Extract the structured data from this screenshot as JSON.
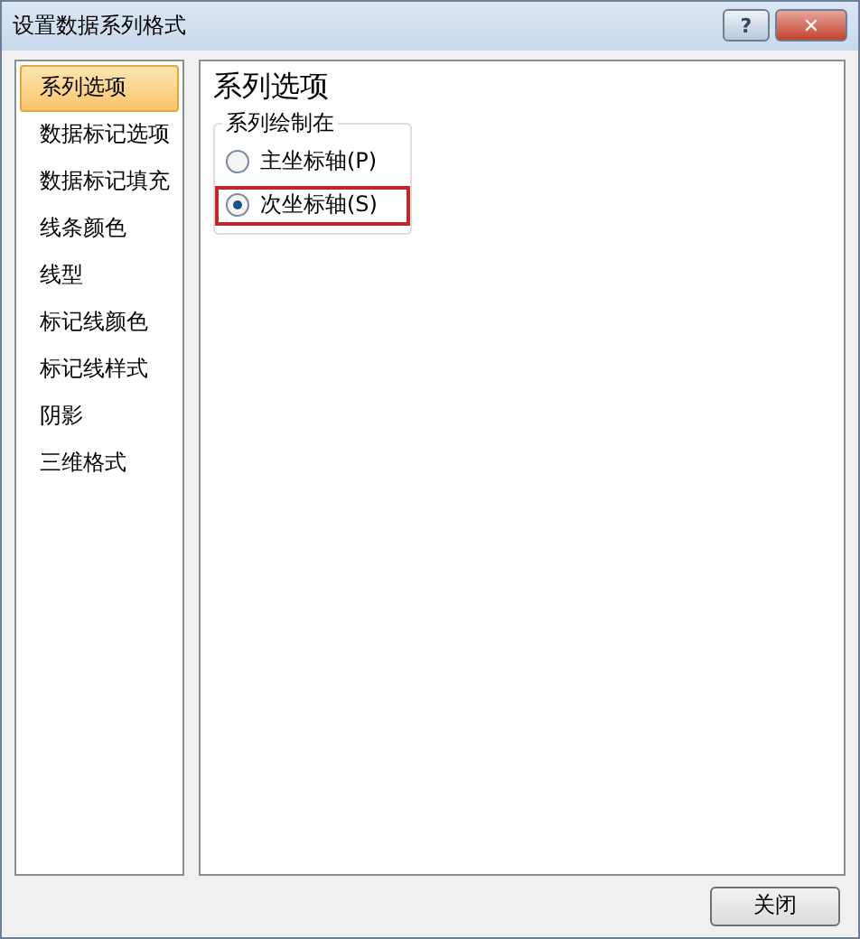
{
  "window": {
    "title": "设置数据系列格式",
    "help_button": "?",
    "close_button": "✕"
  },
  "sidebar": {
    "items": [
      {
        "label": "系列选项",
        "selected": true
      },
      {
        "label": "数据标记选项",
        "selected": false
      },
      {
        "label": "数据标记填充",
        "selected": false
      },
      {
        "label": "线条颜色",
        "selected": false
      },
      {
        "label": "线型",
        "selected": false
      },
      {
        "label": "标记线颜色",
        "selected": false
      },
      {
        "label": "标记线样式",
        "selected": false
      },
      {
        "label": "阴影",
        "selected": false
      },
      {
        "label": "三维格式",
        "selected": false
      }
    ]
  },
  "panel": {
    "title": "系列选项",
    "group": {
      "legend": "系列绘制在",
      "options": [
        {
          "label": "主坐标轴(P)",
          "selected": false,
          "highlighted": false
        },
        {
          "label": "次坐标轴(S)",
          "selected": true,
          "highlighted": true
        }
      ]
    }
  },
  "footer": {
    "close_label": "关闭"
  }
}
